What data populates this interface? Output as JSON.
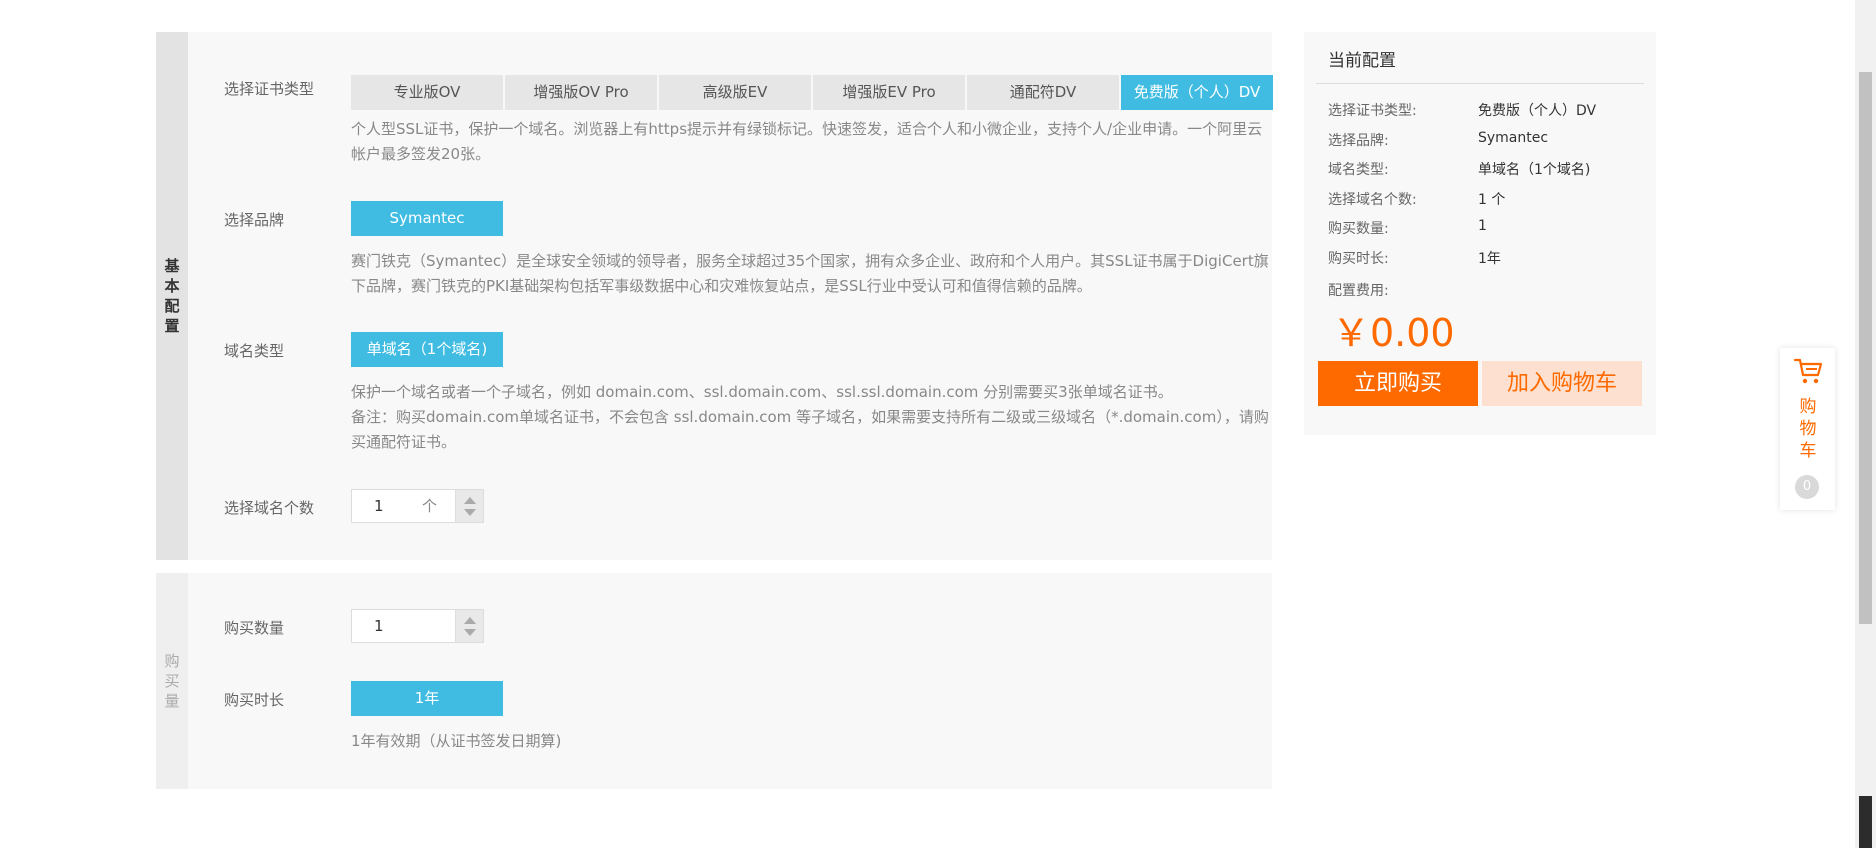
{
  "basic": {
    "tab_label": "基本配置",
    "cert_type": {
      "label": "选择证书类型",
      "tabs": [
        "专业版OV",
        "增强版OV Pro",
        "高级版EV",
        "增强版EV Pro",
        "通配符DV",
        "免费版（个人）DV"
      ],
      "active": "免费版（个人）DV",
      "desc": "个人型SSL证书，保护一个域名。浏览器上有https提示并有绿锁标记。快速签发，适合个人和小微企业，支持个人/企业申请。一个阿里云帐户最多签发20张。"
    },
    "brand": {
      "label": "选择品牌",
      "value": "Symantec",
      "desc": "赛门铁克（Symantec）是全球安全领域的领导者，服务全球超过35个国家，拥有众多企业、政府和个人用户。其SSL证书属于DigiCert旗下品牌，赛门铁克的PKI基础架构包括军事级数据中心和灾难恢复站点，是SSL行业中受认可和值得信赖的品牌。"
    },
    "domain_type": {
      "label": "域名类型",
      "value": "单域名（1个域名)",
      "desc_line1": "保护一个域名或者一个子域名，例如 domain.com、ssl.domain.com、ssl.ssl.domain.com 分别需要买3张单域名证书。",
      "desc_line2": "备注：购买domain.com单域名证书，不会包含 ssl.domain.com 等子域名，如果需要支持所有二级或三级域名（*.domain.com），请购买通配符证书。"
    },
    "domain_count": {
      "label": "选择域名个数",
      "value": "1",
      "unit": "个"
    }
  },
  "purchase": {
    "tab_label": "购买量",
    "quantity": {
      "label": "购买数量",
      "value": "1"
    },
    "duration": {
      "label": "购买时长",
      "value": "1年",
      "desc": "1年有效期（从证书签发日期算)"
    }
  },
  "summary": {
    "title": "当前配置",
    "rows": [
      {
        "label": "选择证书类型:",
        "value": "免费版（个人）DV"
      },
      {
        "label": "选择品牌:",
        "value": "Symantec"
      },
      {
        "label": "域名类型:",
        "value": "单域名（1个域名)"
      },
      {
        "label": "选择域名个数:",
        "value": "1 个"
      },
      {
        "label": "购买数量:",
        "value": "1"
      },
      {
        "label": "购买时长:",
        "value": "1年"
      }
    ],
    "fee_label": "配置费用:",
    "price": "￥0.00",
    "buy_button": "立即购买",
    "cart_button": "加入购物车"
  },
  "float_cart": {
    "label": "购物车",
    "count": "0"
  },
  "colors": {
    "accent": "#40bce2",
    "orange": "#ff6a00",
    "cart_light": "#fde0cf"
  }
}
